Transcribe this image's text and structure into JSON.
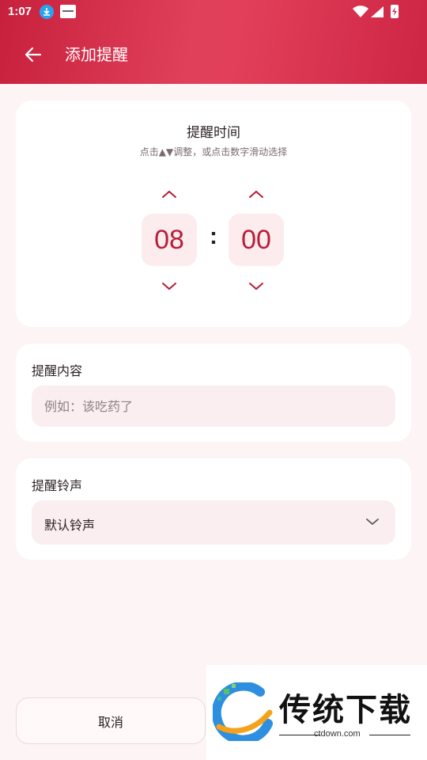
{
  "status_bar": {
    "time": "1:07"
  },
  "app_bar": {
    "title": "添加提醒"
  },
  "time_card": {
    "title": "提醒时间",
    "hint": "点击▲▼调整，或点击数字滑动选择",
    "hour": "08",
    "separator": ":",
    "minute": "00"
  },
  "content_card": {
    "label": "提醒内容",
    "placeholder": "例如：该吃药了",
    "value": ""
  },
  "ringtone_card": {
    "label": "提醒铃声",
    "selected": "默认铃声"
  },
  "footer": {
    "cancel_label": "取消"
  },
  "watermark": {
    "brand": "传统下载",
    "site": "ctdown.com"
  },
  "colors": {
    "accent": "#d2304b",
    "number": "#b81d38",
    "field_bg": "#fbeef0",
    "page_bg": "#fdf5f5"
  }
}
